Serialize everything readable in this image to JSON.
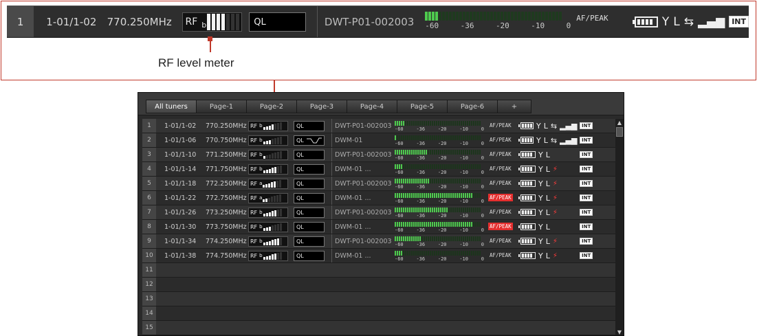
{
  "callout": {
    "label": "RF level meter"
  },
  "zoom": {
    "row_number": "1",
    "channel": "1-01/1-02",
    "frequency": "770.250MHz",
    "rf_label": "RF",
    "rf_sub": "b",
    "rf_level_bars_on": 4,
    "ql_label": "QL",
    "name": "DWT-P01-002003",
    "af_level_fraction": 0.1,
    "af_scale": [
      "-60",
      "-36",
      "-20",
      "-10",
      "0"
    ],
    "af_peak": "AF/PEAK",
    "int_badge": "INT"
  },
  "tabs": [
    {
      "label": "All tuners",
      "active": true
    },
    {
      "label": "Page-1",
      "active": false
    },
    {
      "label": "Page-2",
      "active": false
    },
    {
      "label": "Page-3",
      "active": false
    },
    {
      "label": "Page-4",
      "active": false
    },
    {
      "label": "Page-5",
      "active": false
    },
    {
      "label": "Page-6",
      "active": false
    },
    {
      "label": "+",
      "active": false
    }
  ],
  "rows": [
    {
      "n": "1",
      "ch": "1-01/1-02",
      "freq": "770.250MHz",
      "rf": "RF",
      "rf_sub": "b",
      "bars_on": 4,
      "ql": "QL",
      "name": "DWT-P01-002003",
      "af": 0.12,
      "af_red": false,
      "peak": "AF/PEAK",
      "peak_hot": false,
      "scale": [
        "-60",
        "-36",
        "-20",
        "-10",
        "0"
      ],
      "icons": "full",
      "int": "INT"
    },
    {
      "n": "2",
      "ch": "1-01/1-06",
      "freq": "770.750MHz",
      "rf": "RF",
      "rf_sub": "b",
      "bars_on": 3,
      "ql": "QL",
      "name": "DWM-01",
      "af": 0.02,
      "af_red": false,
      "peak": "AF/PEAK",
      "peak_hot": false,
      "scale": [
        "-60",
        "-36",
        "-20",
        "-10",
        "0"
      ],
      "icons": "full",
      "int": "INT"
    },
    {
      "n": "3",
      "ch": "1-01/1-10",
      "freq": "771.250MHz",
      "rf": "RF",
      "rf_sub": "b",
      "bars_on": 1,
      "ql": "QL",
      "name": "DWT-P01-002003",
      "af": 0.38,
      "af_red": false,
      "peak": "AF/PEAK",
      "peak_hot": false,
      "scale": [
        "-60",
        "-36",
        "-20",
        "-10",
        "0"
      ],
      "icons": "noconn",
      "int": "INT"
    },
    {
      "n": "4",
      "ch": "1-01/1-14",
      "freq": "771.750MHz",
      "rf": "RF",
      "rf_sub": "b",
      "bars_on": 5,
      "ql": "QL",
      "name": "DWM-01 ...",
      "af": 0.1,
      "af_red": false,
      "peak": "AF/PEAK",
      "peak_hot": false,
      "scale": [
        "-60",
        "-36",
        "-20",
        "-10",
        "0"
      ],
      "icons": "warn",
      "int": "INT"
    },
    {
      "n": "5",
      "ch": "1-01/1-18",
      "freq": "772.250MHz",
      "rf": "RF",
      "rf_sub": "a",
      "bars_on": 5,
      "ql": "QL",
      "name": "DWT-P01-002003",
      "af": 0.4,
      "af_red": false,
      "peak": "AF/PEAK",
      "peak_hot": false,
      "scale": [
        "-60",
        "-36",
        "-20",
        "-10",
        "0"
      ],
      "icons": "warn",
      "int": "INT"
    },
    {
      "n": "6",
      "ch": "1-01/1-22",
      "freq": "772.750MHz",
      "rf": "RF",
      "rf_sub": "a",
      "bars_on": 2,
      "ql": "QL",
      "name": "DWM-01 ...",
      "af": 0.9,
      "af_red": true,
      "peak": "AF/PEAK",
      "peak_hot": true,
      "scale": [
        "-60",
        "-36",
        "-20",
        "-10",
        "0"
      ],
      "icons": "warn",
      "int": "INT"
    },
    {
      "n": "7",
      "ch": "1-01/1-26",
      "freq": "773.250MHz",
      "rf": "RF",
      "rf_sub": "b",
      "bars_on": 5,
      "ql": "QL",
      "name": "DWT-P01-002003",
      "af": 0.62,
      "af_red": false,
      "peak": "AF/PEAK",
      "peak_hot": false,
      "scale": [
        "-60",
        "-36",
        "-20",
        "-10",
        "0"
      ],
      "icons": "warn",
      "int": "INT"
    },
    {
      "n": "8",
      "ch": "1-01/1-30",
      "freq": "773.750MHz",
      "rf": "RF",
      "rf_sub": "b",
      "bars_on": 3,
      "ql": "QL",
      "name": "DWM-01 ...",
      "af": 0.9,
      "af_red": true,
      "peak": "AF/PEAK",
      "peak_hot": true,
      "scale": [
        "-60",
        "-36",
        "-20",
        "-10",
        "0"
      ],
      "icons": "noconn",
      "int": "INT"
    },
    {
      "n": "9",
      "ch": "1-01/1-34",
      "freq": "774.250MHz",
      "rf": "RF",
      "rf_sub": "b",
      "bars_on": 6,
      "ql": "QL",
      "name": "DWT-P01-002003",
      "af": 0.3,
      "af_red": false,
      "peak": "AF/PEAK",
      "peak_hot": false,
      "scale": [
        "-60",
        "-36",
        "-20",
        "-10",
        "0"
      ],
      "icons": "warn",
      "int": "INT"
    },
    {
      "n": "10",
      "ch": "1-01/1-38",
      "freq": "774.750MHz",
      "rf": "RF",
      "rf_sub": "b",
      "bars_on": 5,
      "ql": "QL",
      "name": "DWM-01 ...",
      "af": 0.1,
      "af_red": false,
      "peak": "AF/PEAK",
      "peak_hot": false,
      "scale": [
        "-60",
        "-36",
        "-20",
        "-10",
        "0"
      ],
      "icons": "warn",
      "int": "INT"
    },
    {
      "n": "11"
    },
    {
      "n": "12"
    },
    {
      "n": "13"
    },
    {
      "n": "14"
    },
    {
      "n": "15"
    }
  ],
  "glyphs": {
    "antenna": "Y",
    "diversity": "L",
    "link": "⇆",
    "signal": "▂▄▆",
    "warn": "⚡",
    "up": "▲",
    "down": "▼"
  }
}
